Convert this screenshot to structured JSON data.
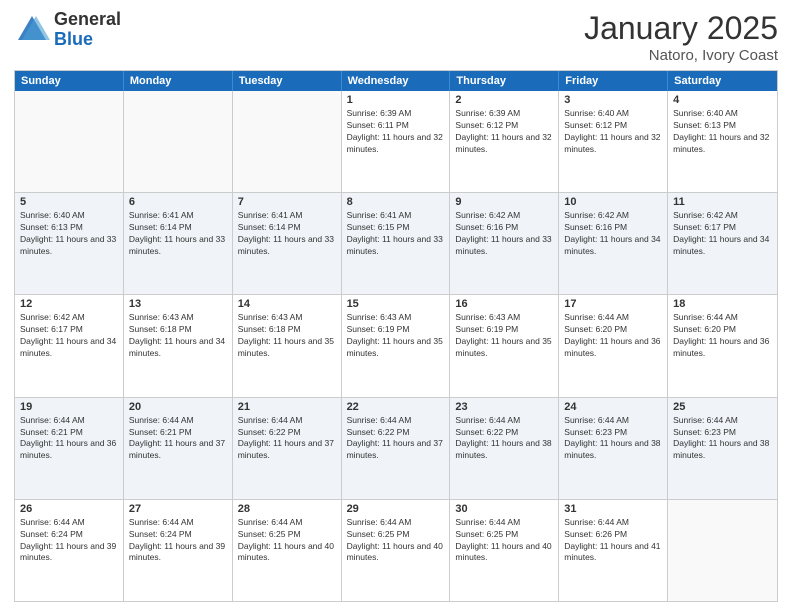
{
  "logo": {
    "general": "General",
    "blue": "Blue"
  },
  "header": {
    "month": "January 2025",
    "location": "Natoro, Ivory Coast"
  },
  "weekdays": [
    "Sunday",
    "Monday",
    "Tuesday",
    "Wednesday",
    "Thursday",
    "Friday",
    "Saturday"
  ],
  "rows": [
    [
      {
        "day": "",
        "sunrise": "",
        "sunset": "",
        "daylight": "",
        "empty": true
      },
      {
        "day": "",
        "sunrise": "",
        "sunset": "",
        "daylight": "",
        "empty": true
      },
      {
        "day": "",
        "sunrise": "",
        "sunset": "",
        "daylight": "",
        "empty": true
      },
      {
        "day": "1",
        "sunrise": "Sunrise: 6:39 AM",
        "sunset": "Sunset: 6:11 PM",
        "daylight": "Daylight: 11 hours and 32 minutes."
      },
      {
        "day": "2",
        "sunrise": "Sunrise: 6:39 AM",
        "sunset": "Sunset: 6:12 PM",
        "daylight": "Daylight: 11 hours and 32 minutes."
      },
      {
        "day": "3",
        "sunrise": "Sunrise: 6:40 AM",
        "sunset": "Sunset: 6:12 PM",
        "daylight": "Daylight: 11 hours and 32 minutes."
      },
      {
        "day": "4",
        "sunrise": "Sunrise: 6:40 AM",
        "sunset": "Sunset: 6:13 PM",
        "daylight": "Daylight: 11 hours and 32 minutes."
      }
    ],
    [
      {
        "day": "5",
        "sunrise": "Sunrise: 6:40 AM",
        "sunset": "Sunset: 6:13 PM",
        "daylight": "Daylight: 11 hours and 33 minutes."
      },
      {
        "day": "6",
        "sunrise": "Sunrise: 6:41 AM",
        "sunset": "Sunset: 6:14 PM",
        "daylight": "Daylight: 11 hours and 33 minutes."
      },
      {
        "day": "7",
        "sunrise": "Sunrise: 6:41 AM",
        "sunset": "Sunset: 6:14 PM",
        "daylight": "Daylight: 11 hours and 33 minutes."
      },
      {
        "day": "8",
        "sunrise": "Sunrise: 6:41 AM",
        "sunset": "Sunset: 6:15 PM",
        "daylight": "Daylight: 11 hours and 33 minutes."
      },
      {
        "day": "9",
        "sunrise": "Sunrise: 6:42 AM",
        "sunset": "Sunset: 6:16 PM",
        "daylight": "Daylight: 11 hours and 33 minutes."
      },
      {
        "day": "10",
        "sunrise": "Sunrise: 6:42 AM",
        "sunset": "Sunset: 6:16 PM",
        "daylight": "Daylight: 11 hours and 34 minutes."
      },
      {
        "day": "11",
        "sunrise": "Sunrise: 6:42 AM",
        "sunset": "Sunset: 6:17 PM",
        "daylight": "Daylight: 11 hours and 34 minutes."
      }
    ],
    [
      {
        "day": "12",
        "sunrise": "Sunrise: 6:42 AM",
        "sunset": "Sunset: 6:17 PM",
        "daylight": "Daylight: 11 hours and 34 minutes."
      },
      {
        "day": "13",
        "sunrise": "Sunrise: 6:43 AM",
        "sunset": "Sunset: 6:18 PM",
        "daylight": "Daylight: 11 hours and 34 minutes."
      },
      {
        "day": "14",
        "sunrise": "Sunrise: 6:43 AM",
        "sunset": "Sunset: 6:18 PM",
        "daylight": "Daylight: 11 hours and 35 minutes."
      },
      {
        "day": "15",
        "sunrise": "Sunrise: 6:43 AM",
        "sunset": "Sunset: 6:19 PM",
        "daylight": "Daylight: 11 hours and 35 minutes."
      },
      {
        "day": "16",
        "sunrise": "Sunrise: 6:43 AM",
        "sunset": "Sunset: 6:19 PM",
        "daylight": "Daylight: 11 hours and 35 minutes."
      },
      {
        "day": "17",
        "sunrise": "Sunrise: 6:44 AM",
        "sunset": "Sunset: 6:20 PM",
        "daylight": "Daylight: 11 hours and 36 minutes."
      },
      {
        "day": "18",
        "sunrise": "Sunrise: 6:44 AM",
        "sunset": "Sunset: 6:20 PM",
        "daylight": "Daylight: 11 hours and 36 minutes."
      }
    ],
    [
      {
        "day": "19",
        "sunrise": "Sunrise: 6:44 AM",
        "sunset": "Sunset: 6:21 PM",
        "daylight": "Daylight: 11 hours and 36 minutes."
      },
      {
        "day": "20",
        "sunrise": "Sunrise: 6:44 AM",
        "sunset": "Sunset: 6:21 PM",
        "daylight": "Daylight: 11 hours and 37 minutes."
      },
      {
        "day": "21",
        "sunrise": "Sunrise: 6:44 AM",
        "sunset": "Sunset: 6:22 PM",
        "daylight": "Daylight: 11 hours and 37 minutes."
      },
      {
        "day": "22",
        "sunrise": "Sunrise: 6:44 AM",
        "sunset": "Sunset: 6:22 PM",
        "daylight": "Daylight: 11 hours and 37 minutes."
      },
      {
        "day": "23",
        "sunrise": "Sunrise: 6:44 AM",
        "sunset": "Sunset: 6:22 PM",
        "daylight": "Daylight: 11 hours and 38 minutes."
      },
      {
        "day": "24",
        "sunrise": "Sunrise: 6:44 AM",
        "sunset": "Sunset: 6:23 PM",
        "daylight": "Daylight: 11 hours and 38 minutes."
      },
      {
        "day": "25",
        "sunrise": "Sunrise: 6:44 AM",
        "sunset": "Sunset: 6:23 PM",
        "daylight": "Daylight: 11 hours and 38 minutes."
      }
    ],
    [
      {
        "day": "26",
        "sunrise": "Sunrise: 6:44 AM",
        "sunset": "Sunset: 6:24 PM",
        "daylight": "Daylight: 11 hours and 39 minutes."
      },
      {
        "day": "27",
        "sunrise": "Sunrise: 6:44 AM",
        "sunset": "Sunset: 6:24 PM",
        "daylight": "Daylight: 11 hours and 39 minutes."
      },
      {
        "day": "28",
        "sunrise": "Sunrise: 6:44 AM",
        "sunset": "Sunset: 6:25 PM",
        "daylight": "Daylight: 11 hours and 40 minutes."
      },
      {
        "day": "29",
        "sunrise": "Sunrise: 6:44 AM",
        "sunset": "Sunset: 6:25 PM",
        "daylight": "Daylight: 11 hours and 40 minutes."
      },
      {
        "day": "30",
        "sunrise": "Sunrise: 6:44 AM",
        "sunset": "Sunset: 6:25 PM",
        "daylight": "Daylight: 11 hours and 40 minutes."
      },
      {
        "day": "31",
        "sunrise": "Sunrise: 6:44 AM",
        "sunset": "Sunset: 6:26 PM",
        "daylight": "Daylight: 11 hours and 41 minutes."
      },
      {
        "day": "",
        "sunrise": "",
        "sunset": "",
        "daylight": "",
        "empty": true
      }
    ]
  ]
}
